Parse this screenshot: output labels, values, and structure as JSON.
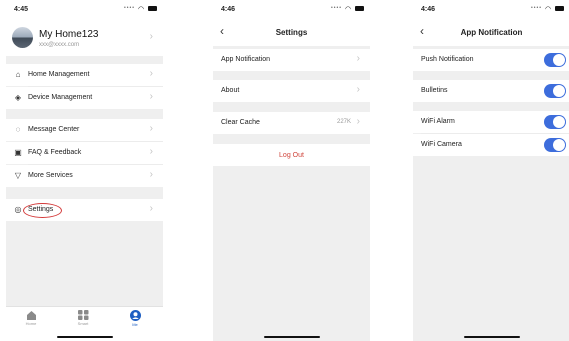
{
  "screen1": {
    "time": "4:45",
    "profile": {
      "name": "My Home123",
      "email": "xxx@xxxx.com"
    },
    "menu": {
      "home_management": "Home Management",
      "device_management": "Device Management",
      "message_center": "Message Center",
      "faq_feedback": "FAQ & Feedback",
      "more_services": "More Services",
      "settings": "Settings"
    },
    "tabs": {
      "home": "Home",
      "smart": "Smart",
      "me": "Me"
    }
  },
  "screen2": {
    "time": "4:46",
    "title": "Settings",
    "items": {
      "app_notification": "App Notification",
      "about": "About",
      "clear_cache": "Clear Cache",
      "cache_size": "227K"
    },
    "logout": "Log Out"
  },
  "screen3": {
    "time": "4:46",
    "title": "App Notification",
    "toggles": [
      {
        "label": "Push Notification",
        "on": true
      },
      {
        "label": "Bulletins",
        "on": true
      },
      {
        "label": "WiFi Alarm",
        "on": true
      },
      {
        "label": "WiFi Camera",
        "on": true
      }
    ]
  },
  "colors": {
    "toggle_on": "#3d6ddc",
    "accent_tab": "#1d5ec2",
    "logout": "#d0453c",
    "highlight_circle": "#d43a3a"
  },
  "icons": {
    "home_management": "house-icon",
    "device_management": "layers-icon",
    "message_center": "chat-icon",
    "faq_feedback": "note-icon",
    "more_services": "shield-icon",
    "settings": "gear-icon"
  }
}
